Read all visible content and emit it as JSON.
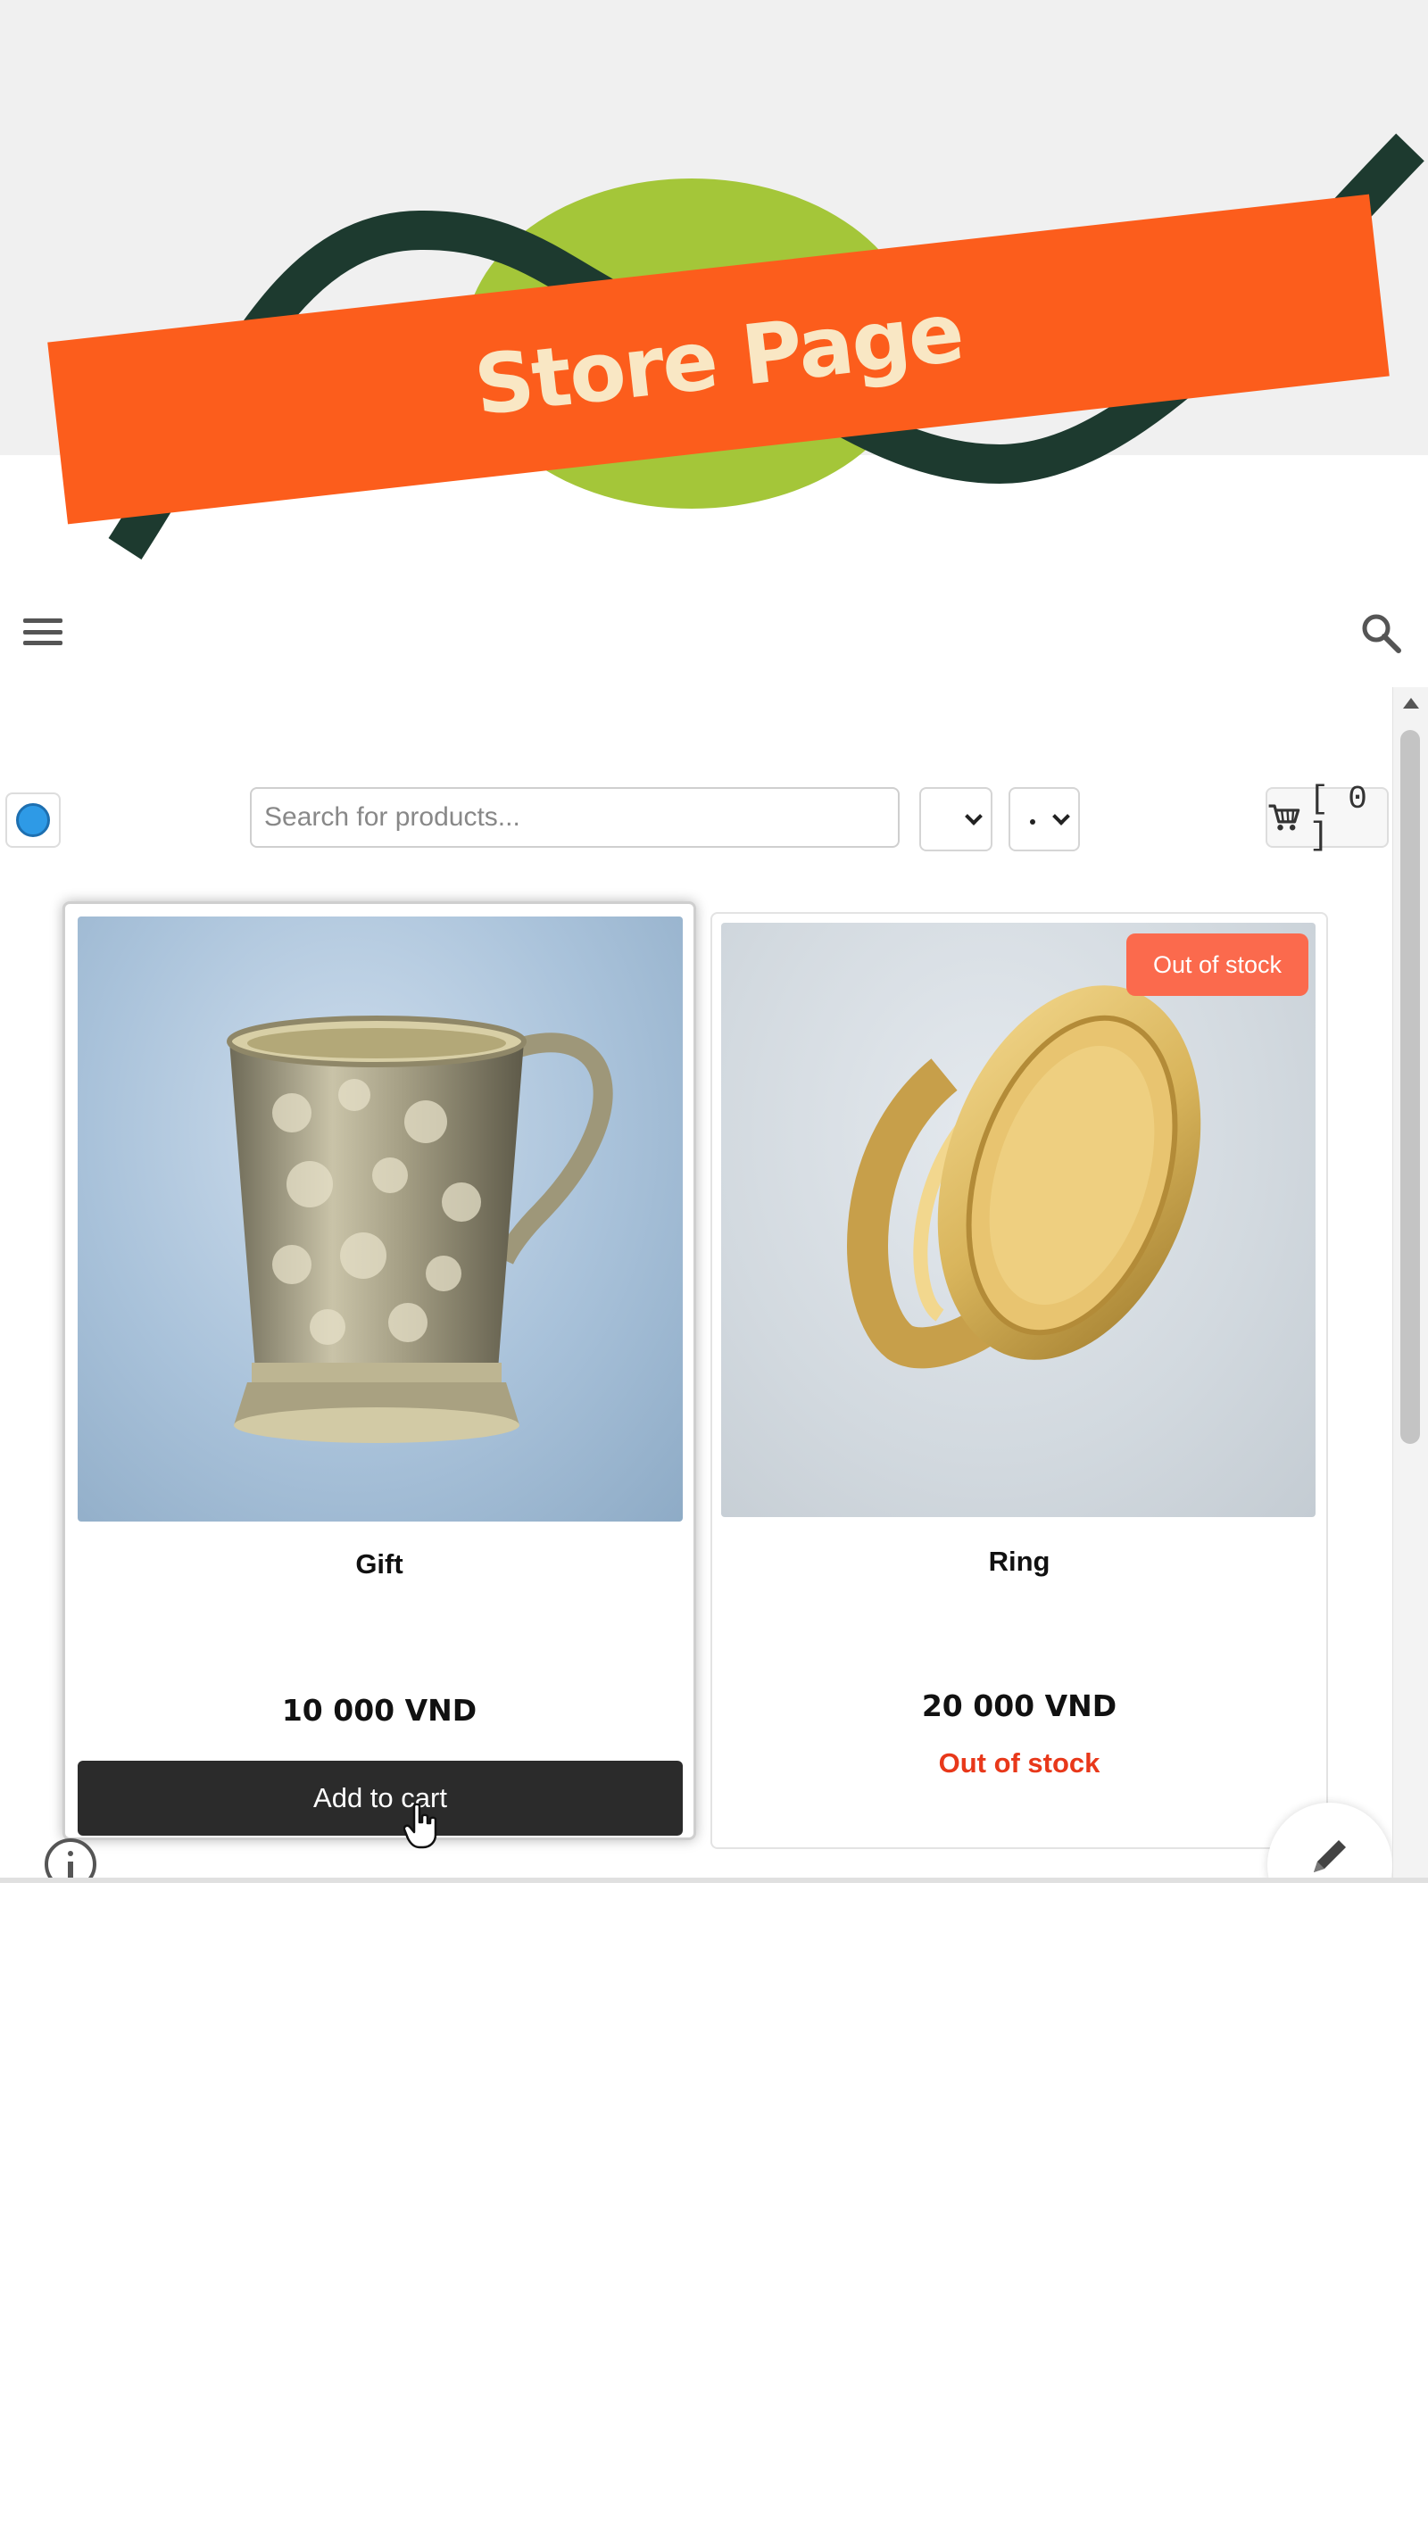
{
  "banner": {
    "title": "Store Page",
    "colors": {
      "ribbon": "#fc5d1c",
      "ribbon_text": "#f9e7c4",
      "blob": "#a4c639",
      "swoosh": "#1d3a2f"
    }
  },
  "nav": {
    "menu_icon": "hamburger-menu-icon",
    "search_icon": "magnifier-icon"
  },
  "toolbar": {
    "language_icon": "globe-icon",
    "search_placeholder": "Search for products...",
    "select_1": "",
    "select_2": "",
    "cart_icon": "shopping-cart-icon",
    "cart_count": "[ 0 ]"
  },
  "products": [
    {
      "name": "Gift",
      "price": "10 000 VND",
      "action": "Add to cart",
      "image": "engraved-silver-mug"
    },
    {
      "name": "Ring",
      "price": "20 000 VND",
      "badge": "Out of stock",
      "status": "Out of stock",
      "image": "gold-signet-ring"
    }
  ],
  "footer": {
    "info_icon": "info-circle-icon",
    "edit_icon": "pencil-icon"
  }
}
